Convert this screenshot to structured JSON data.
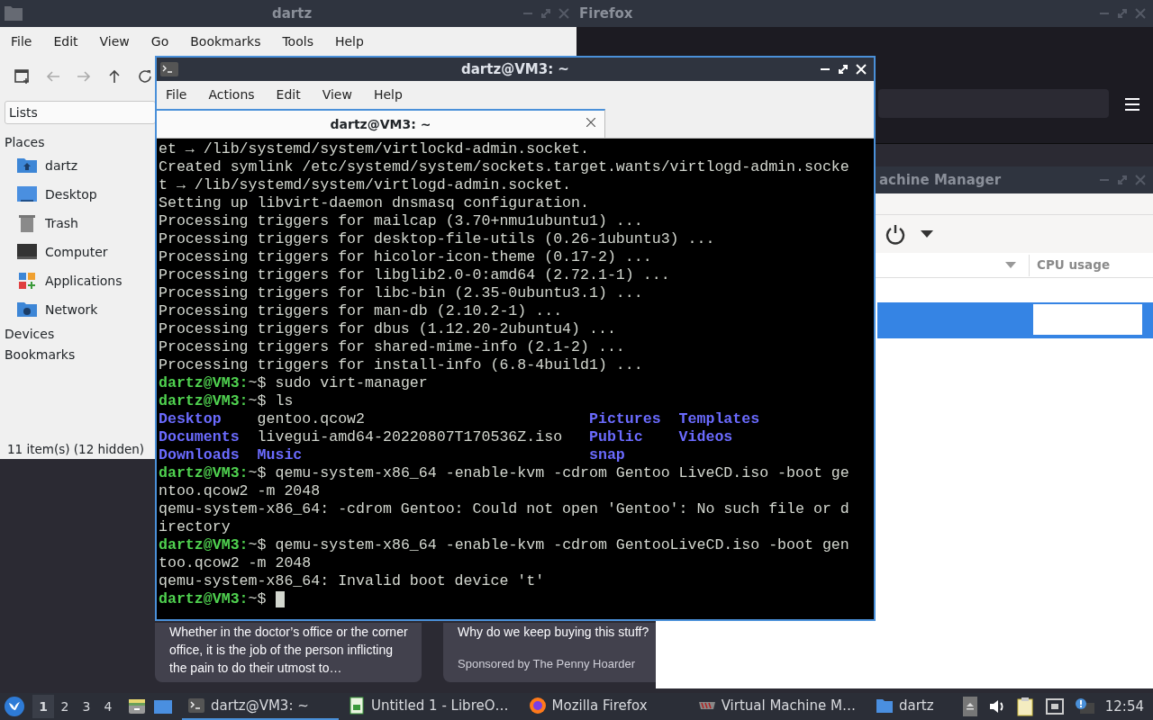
{
  "file_manager": {
    "title": "dartz",
    "menu": [
      "File",
      "Edit",
      "View",
      "Go",
      "Bookmarks",
      "Tools",
      "Help"
    ],
    "location_mode": "Lists",
    "places_label": "Places",
    "places": [
      {
        "label": "dartz",
        "kind": "home"
      },
      {
        "label": "Desktop",
        "kind": "desktop"
      },
      {
        "label": "Trash",
        "kind": "trash"
      },
      {
        "label": "Computer",
        "kind": "computer"
      },
      {
        "label": "Applications",
        "kind": "apps"
      },
      {
        "label": "Network",
        "kind": "network"
      }
    ],
    "sections": [
      "Devices",
      "Bookmarks"
    ],
    "status": "11 item(s) (12 hidden)"
  },
  "firefox": {
    "title": "Firefox",
    "cards": [
      {
        "text": "Whether in the doctor’s office or the corner office, it is the job of the person inflicting the pain to do their utmost to…"
      },
      {
        "text": "Why do we keep buying this stuff?",
        "sponsor": "Sponsored by The Penny Hoarder"
      }
    ]
  },
  "virt_manager": {
    "title": "achine Manager",
    "columns": [
      "CPU usage"
    ],
    "rows": [
      {
        "selected": true
      }
    ]
  },
  "terminal": {
    "title": "dartz@VM3: ~",
    "menu": [
      "File",
      "Actions",
      "Edit",
      "View",
      "Help"
    ],
    "tab": {
      "label": "dartz@VM3: ~",
      "selected": true
    },
    "lines": [
      {
        "kind": "output",
        "text": "et → /lib/systemd/system/virtlockd-admin.socket."
      },
      {
        "kind": "output",
        "text": "Created symlink /etc/systemd/system/sockets.target.wants/virtlogd-admin.socke"
      },
      {
        "kind": "output",
        "text": "t → /lib/systemd/system/virtlogd-admin.socket."
      },
      {
        "kind": "output",
        "text": "Setting up libvirt-daemon dnsmasq configuration."
      },
      {
        "kind": "output",
        "text": "Processing triggers for mailcap (3.70+nmu1ubuntu1) ..."
      },
      {
        "kind": "output",
        "text": "Processing triggers for desktop-file-utils (0.26-1ubuntu3) ..."
      },
      {
        "kind": "output",
        "text": "Processing triggers for hicolor-icon-theme (0.17-2) ..."
      },
      {
        "kind": "output",
        "text": "Processing triggers for libglib2.0-0:amd64 (2.72.1-1) ..."
      },
      {
        "kind": "output",
        "text": "Processing triggers for libc-bin (2.35-0ubuntu3.1) ..."
      },
      {
        "kind": "output",
        "text": "Processing triggers for man-db (2.10.2-1) ..."
      },
      {
        "kind": "output",
        "text": "Processing triggers for dbus (1.12.20-2ubuntu4) ..."
      },
      {
        "kind": "output",
        "text": "Processing triggers for shared-mime-info (2.1-2) ..."
      },
      {
        "kind": "output",
        "text": "Processing triggers for install-info (6.8-4build1) ..."
      },
      {
        "kind": "prompt",
        "user": "dartz@VM3:",
        "path": "~$",
        "command": "sudo virt-manager"
      },
      {
        "kind": "prompt",
        "user": "dartz@VM3:",
        "path": "~$",
        "command": "ls"
      },
      {
        "kind": "listing",
        "cells": [
          {
            "text": "Desktop",
            "dir": true
          },
          {
            "text": "gentoo.qcow2",
            "dir": false
          },
          {
            "text": "Pictures",
            "dir": true
          },
          {
            "text": "Templates",
            "dir": true
          }
        ]
      },
      {
        "kind": "listing",
        "cells": [
          {
            "text": "Documents",
            "dir": true
          },
          {
            "text": "livegui-amd64-20220807T170536Z.iso",
            "dir": false
          },
          {
            "text": "Public",
            "dir": true
          },
          {
            "text": "Videos",
            "dir": true
          }
        ]
      },
      {
        "kind": "listing",
        "cells": [
          {
            "text": "Downloads",
            "dir": true
          },
          {
            "text": "Music",
            "dir": true
          },
          {
            "text": "snap",
            "dir": true
          }
        ]
      },
      {
        "kind": "prompt",
        "user": "dartz@VM3:",
        "path": "~$",
        "command": "qemu-system-x86_64 -enable-kvm -cdrom Gentoo LiveCD.iso -boot ge"
      },
      {
        "kind": "output",
        "text": "ntoo.qcow2 -m 2048"
      },
      {
        "kind": "output",
        "text": "qemu-system-x86_64: -cdrom Gentoo: Could not open 'Gentoo': No such file or d"
      },
      {
        "kind": "output",
        "text": "irectory"
      },
      {
        "kind": "prompt",
        "user": "dartz@VM3:",
        "path": "~$",
        "command": "qemu-system-x86_64 -enable-kvm -cdrom GentooLiveCD.iso -boot gen"
      },
      {
        "kind": "output",
        "text": "too.qcow2 -m 2048"
      },
      {
        "kind": "output",
        "text": "qemu-system-x86_64: Invalid boot device 't'"
      },
      {
        "kind": "prompt",
        "user": "dartz@VM3:",
        "path": "~$",
        "cursor": true
      }
    ]
  },
  "taskbar": {
    "workspaces": [
      {
        "label": "1",
        "selected": true
      },
      {
        "label": "2",
        "selected": false
      },
      {
        "label": "3",
        "selected": false
      },
      {
        "label": "4",
        "selected": false
      }
    ],
    "tasks": [
      {
        "label": "dartz@VM3: ~",
        "kind": "terminal",
        "active": true
      },
      {
        "label": "Untitled 1 - LibreO…",
        "kind": "spreadsheet",
        "active": false
      },
      {
        "label": "Mozilla Firefox",
        "kind": "browser",
        "active": false
      },
      {
        "label": "Virtual Machine M…",
        "kind": "vm",
        "active": false
      },
      {
        "label": "dartz",
        "kind": "folder",
        "active": false
      }
    ],
    "clock": "12:54"
  }
}
